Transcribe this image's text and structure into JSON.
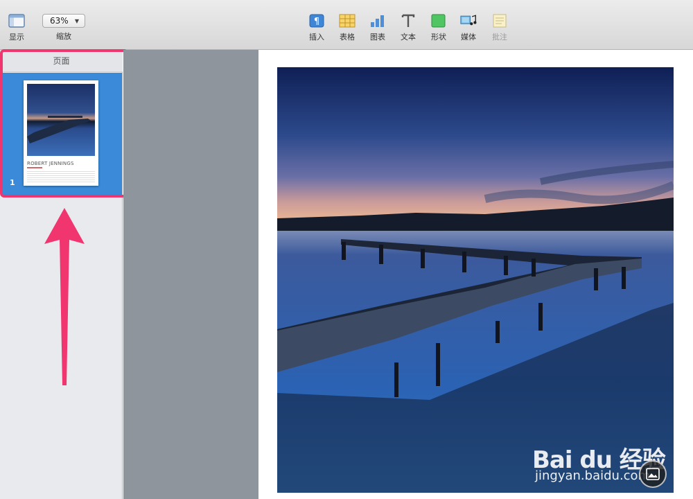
{
  "toolbar": {
    "view_label": "显示",
    "zoom_value": "63%",
    "zoom_label": "缩放",
    "insert_label": "插入",
    "table_label": "表格",
    "chart_label": "图表",
    "text_label": "文本",
    "shape_label": "形状",
    "media_label": "媒体",
    "comment_label": "批注"
  },
  "sidebar": {
    "header": "页面",
    "pages": [
      {
        "number": "1",
        "thumb_title": "ROBERT JENNINGS"
      }
    ]
  },
  "watermark": {
    "logo": "Bai du 经验",
    "url": "jingyan.baidu.com"
  },
  "colors": {
    "selection": "#3a8ad9",
    "highlight": "#f0356f",
    "arrow": "#f0356f"
  }
}
